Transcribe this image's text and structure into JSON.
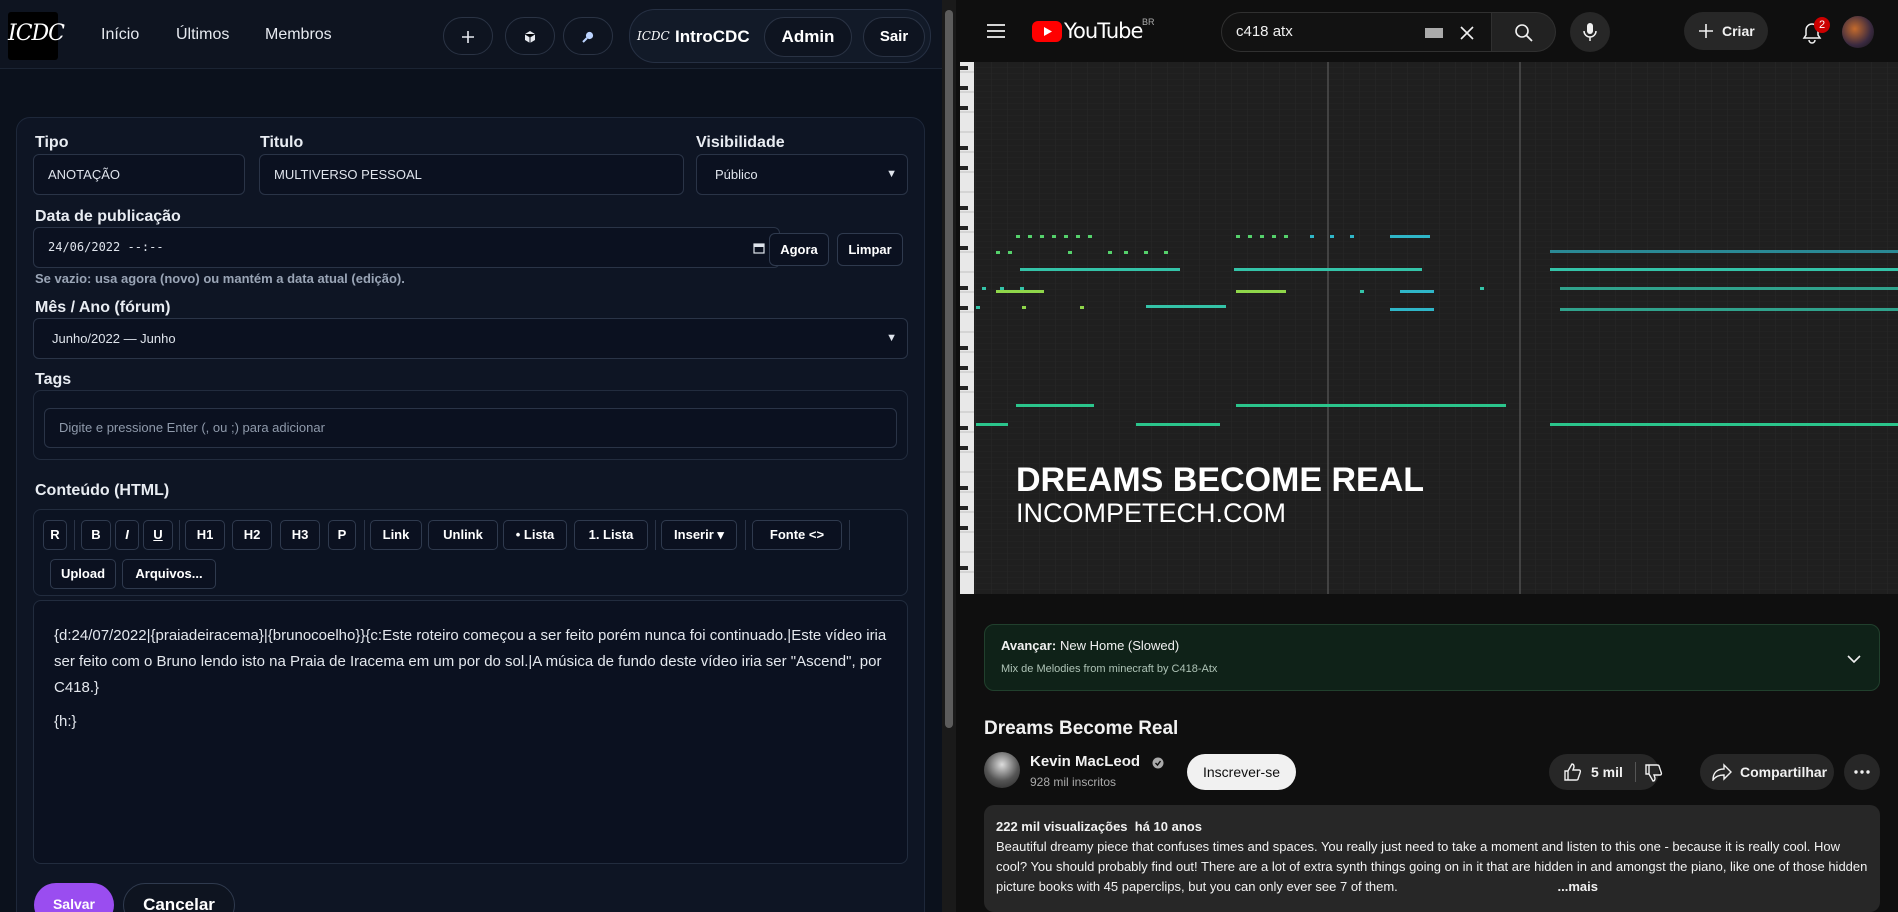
{
  "left_nav": {
    "logo_text": "ICDC",
    "links": [
      "Início",
      "Últimos",
      "Membros"
    ],
    "icon_buttons": [
      "plus-icon",
      "cube-icon",
      "search-icon"
    ],
    "account_logo": "ICDC",
    "account_name": "IntroCDC",
    "admin_label": "Admin",
    "logout_label": "Sair"
  },
  "form": {
    "tipo_label": "Tipo",
    "tipo_value": "ANOTAÇÃO",
    "titulo_label": "Titulo",
    "titulo_value": "MULTIVERSO PESSOAL",
    "visibilidade_label": "Visibilidade",
    "visibilidade_value": "Público",
    "data_label": "Data de publicação",
    "data_value": "24/06/2022  --:--",
    "agora_label": "Agora",
    "limpar_label": "Limpar",
    "data_hint": "Se vazio: usa agora (novo) ou mantém a data atual (edição).",
    "mes_label": "Mês / Ano (fórum)",
    "mes_value": "Junho/2022 — Junho",
    "tags_label": "Tags",
    "tags_placeholder": "Digite e pressione Enter (, ou ;) para adicionar",
    "conteudo_label": "Conteúdo (HTML)",
    "toolbar": {
      "r": "R",
      "b": "B",
      "i": "I",
      "u": "U",
      "h1": "H1",
      "h2": "H2",
      "h3": "H3",
      "p": "P",
      "link": "Link",
      "unlink": "Unlink",
      "ulist": "• Lista",
      "olist": "1. Lista",
      "inserir": "Inserir ▾",
      "fonte": "Fonte <>",
      "upload": "Upload",
      "arquivos": "Arquivos..."
    },
    "content_p1": "{d:24/07/2022|{praiadeiracema}|{brunocoelho}}{c:Este roteiro começou a ser feito porém nunca foi continuado.|Este vídeo iria ser feito com o Bruno lendo isto na Praia de Iracema em um por do sol.|A música de fundo deste vídeo iria ser \"Ascend\", por C418.}",
    "content_p2": "{h:}",
    "save_label": "Salvar",
    "cancel_label": "Cancelar"
  },
  "youtube": {
    "logo_text": "YouTube",
    "region": "BR",
    "search_value": "c418 atx",
    "create_label": "Criar",
    "notif_count": "2",
    "video_overlay_title": "DREAMS BECOME REAL",
    "video_overlay_sub": "INCOMPETECH.COM",
    "next_label": "Avançar:",
    "next_title": "New Home (Slowed)",
    "next_sub": "Mix de Melodies from minecraft by C418-Atx",
    "title": "Dreams Become Real",
    "channel": "Kevin MacLeod",
    "subscribers": "928 mil inscritos",
    "subscribe_label": "Inscrever-se",
    "likes": "5 mil",
    "share_label": "Compartilhar",
    "views": "222 mil visualizações",
    "age": "há 10 anos",
    "description": "Beautiful dreamy piece that confuses times and spaces. You really just need to take a moment and listen to this one - because it is really cool. How cool? You should probably find out! There are a lot of extra synth things going on in it that are hidden in and amongst the piano, like one of those hidden picture books with 45 paperclips, but you can only ever see 7 of them.",
    "more_label": "...mais"
  },
  "colors": {
    "accent_purple": "#9a4df0",
    "yt_red": "#ff0000"
  }
}
